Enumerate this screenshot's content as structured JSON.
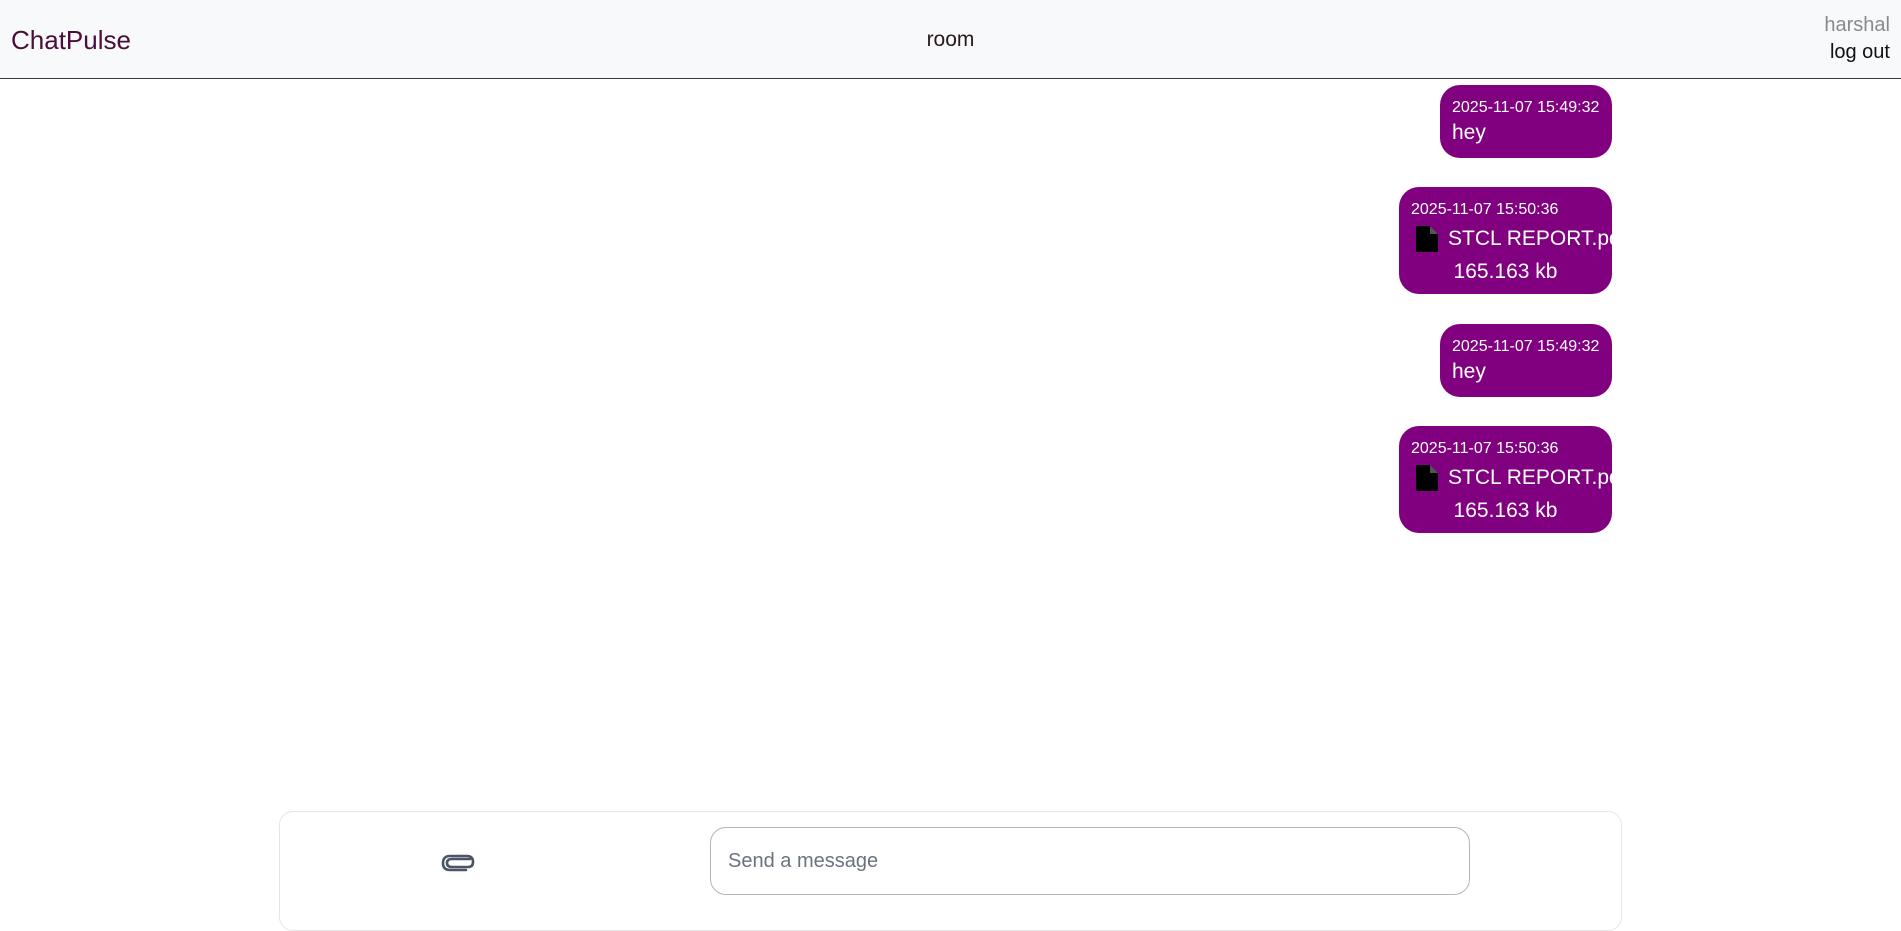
{
  "navbar": {
    "brand": "ChatPulse",
    "room": "room",
    "username": "harshal",
    "logout_label": "log out"
  },
  "messages": [
    {
      "type": "text",
      "timestamp": "2025-11-07 15:49:32",
      "text": "hey"
    },
    {
      "type": "file",
      "timestamp": "2025-11-07 15:50:36",
      "file_name": "STCL REPORT.pdf",
      "file_size": "165.163 kb",
      "icon": "file-icon"
    },
    {
      "type": "text",
      "timestamp": "2025-11-07 15:49:32",
      "text": "hey"
    },
    {
      "type": "file",
      "timestamp": "2025-11-07 15:50:36",
      "file_name": "STCL REPORT.pdf",
      "file_size": "165.163 kb",
      "icon": "file-icon"
    }
  ],
  "composer": {
    "attach_icon": "paperclip-icon",
    "placeholder": "Send a message",
    "value": ""
  },
  "colors": {
    "bubble": "#800080",
    "brand": "#4a0e3a",
    "navbar_bg": "#f8f9fa"
  }
}
